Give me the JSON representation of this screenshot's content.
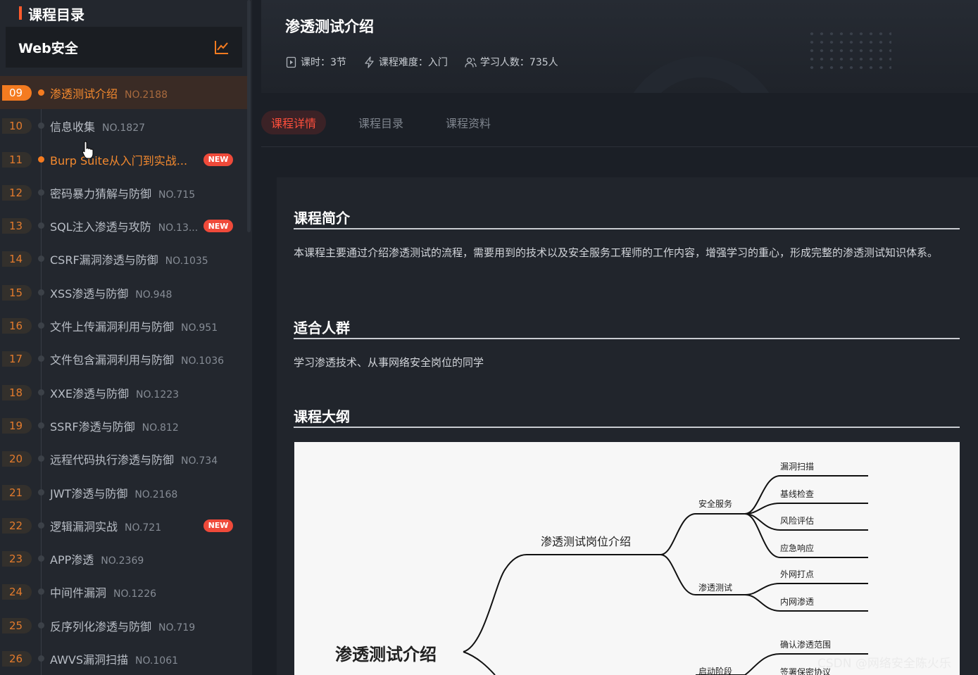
{
  "sidebar": {
    "heading": "课程目录",
    "course_name": "Web安全",
    "chart_icon": "line-chart-icon",
    "lessons": [
      {
        "num": "09",
        "title": "渗透测试介绍",
        "code": "NO.2188",
        "new": false,
        "active": true,
        "highlight": true
      },
      {
        "num": "10",
        "title": "信息收集",
        "code": "NO.1827",
        "new": false,
        "active": false,
        "highlight": false
      },
      {
        "num": "11",
        "title": "Burp Suite从入门到实战...",
        "code": "",
        "new": true,
        "active": false,
        "highlight": true
      },
      {
        "num": "12",
        "title": "密码暴力猜解与防御",
        "code": "NO.715",
        "new": false,
        "active": false,
        "highlight": false
      },
      {
        "num": "13",
        "title": "SQL注入渗透与攻防",
        "code": "NO.13...",
        "new": true,
        "active": false,
        "highlight": false
      },
      {
        "num": "14",
        "title": "CSRF漏洞渗透与防御",
        "code": "NO.1035",
        "new": false,
        "active": false,
        "highlight": false
      },
      {
        "num": "15",
        "title": "XSS渗透与防御",
        "code": "NO.948",
        "new": false,
        "active": false,
        "highlight": false
      },
      {
        "num": "16",
        "title": "文件上传漏洞利用与防御",
        "code": "NO.951",
        "new": false,
        "active": false,
        "highlight": false
      },
      {
        "num": "17",
        "title": "文件包含漏洞利用与防御",
        "code": "NO.1036",
        "new": false,
        "active": false,
        "highlight": false
      },
      {
        "num": "18",
        "title": "XXE渗透与防御",
        "code": "NO.1223",
        "new": false,
        "active": false,
        "highlight": false
      },
      {
        "num": "19",
        "title": "SSRF渗透与防御",
        "code": "NO.812",
        "new": false,
        "active": false,
        "highlight": false
      },
      {
        "num": "20",
        "title": "远程代码执行渗透与防御",
        "code": "NO.734",
        "new": false,
        "active": false,
        "highlight": false
      },
      {
        "num": "21",
        "title": "JWT渗透与防御",
        "code": "NO.2168",
        "new": false,
        "active": false,
        "highlight": false
      },
      {
        "num": "22",
        "title": "逻辑漏洞实战",
        "code": "NO.721",
        "new": true,
        "active": false,
        "highlight": false
      },
      {
        "num": "23",
        "title": "APP渗透",
        "code": "NO.2369",
        "new": false,
        "active": false,
        "highlight": false
      },
      {
        "num": "24",
        "title": "中间件漏洞",
        "code": "NO.1226",
        "new": false,
        "active": false,
        "highlight": false
      },
      {
        "num": "25",
        "title": "反序列化渗透与防御",
        "code": "NO.719",
        "new": false,
        "active": false,
        "highlight": false
      },
      {
        "num": "26",
        "title": "AWVS漏洞扫描",
        "code": "NO.1061",
        "new": false,
        "active": false,
        "highlight": false
      }
    ],
    "new_label": "NEW"
  },
  "header": {
    "title": "渗透测试介绍",
    "hours": "课时：3节",
    "difficulty": "课程难度：入门",
    "learners": "学习人数：735人"
  },
  "tabs": [
    {
      "label": "课程详情",
      "active": true
    },
    {
      "label": "课程目录",
      "active": false
    },
    {
      "label": "课程资料",
      "active": false
    }
  ],
  "content": {
    "intro_title": "课程简介",
    "intro_text": "本课程主要通过介绍渗透测试的流程，需要用到的技术以及安全服务工程师的工作内容，增强学习的重心，形成完整的渗透测试知识体系。",
    "audience_title": "适合人群",
    "audience_text": "学习渗透技术、从事网络安全岗位的同学",
    "outline_title": "课程大纲"
  },
  "mindmap": {
    "root": "渗透测试介绍",
    "branch1": "渗透测试岗位介绍",
    "sub_security": "安全服务",
    "sub_pentest": "渗透测试",
    "leaf_vuln_scan": "漏洞扫描",
    "leaf_baseline": "基线检查",
    "leaf_risk": "风险评估",
    "leaf_response": "应急响应",
    "leaf_external": "外网打点",
    "leaf_internal": "内网渗透",
    "sub_start": "启动阶段",
    "leaf_scope": "确认渗透范围",
    "leaf_agreement": "签署保密协议"
  },
  "watermark": "CSDN @网络安全陈火乐",
  "colors": {
    "accent": "#f47b20",
    "tab_active": "#ff4f3c",
    "new_badge": "#ef4a3a",
    "page_bg": "#1b1f26"
  }
}
